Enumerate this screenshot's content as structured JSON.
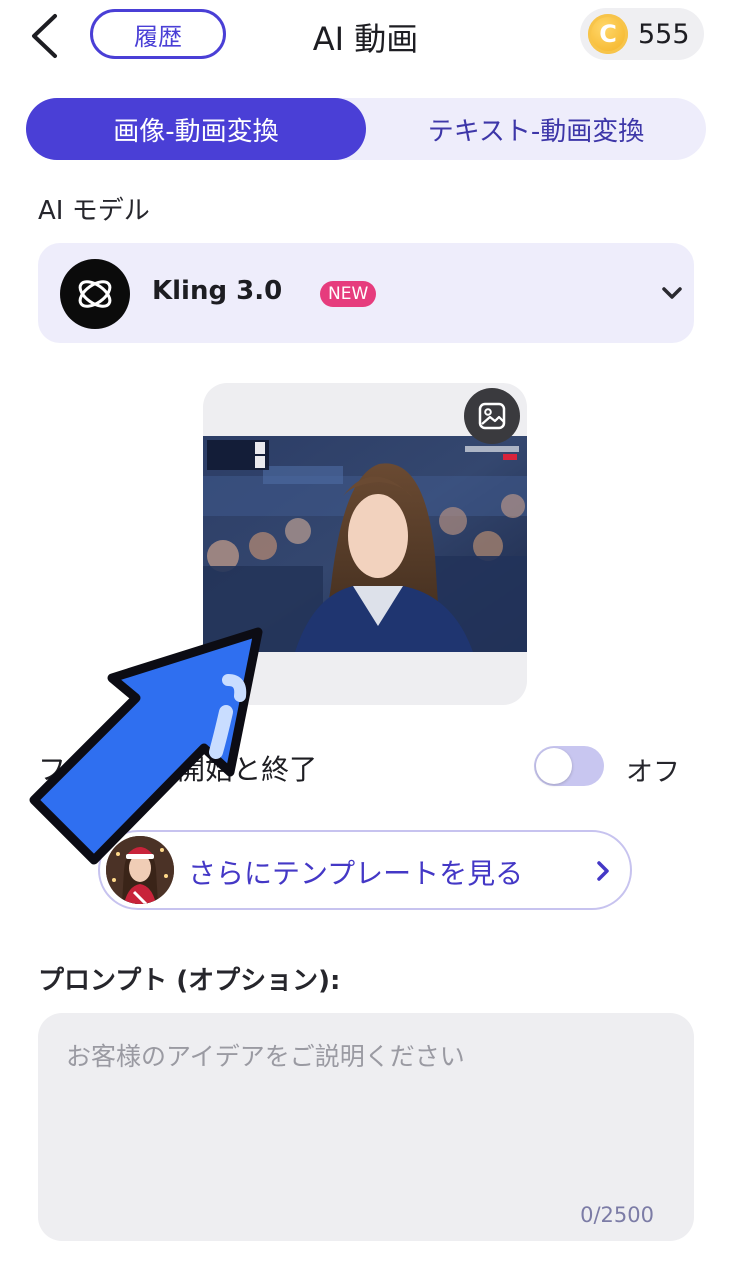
{
  "header": {
    "history_label": "履歴",
    "title": "AI 動画",
    "coin_symbol": "C",
    "coin_balance": "555"
  },
  "mode_tabs": [
    {
      "label": "画像-動画変換",
      "active": true
    },
    {
      "label": "テキスト-動画変換",
      "active": false
    }
  ],
  "model": {
    "section_label": "AI モデル",
    "name": "Kling 3.0",
    "badge": "NEW"
  },
  "frame_option": {
    "label": "フレームの開始と終了",
    "state_label": "オフ",
    "enabled": false
  },
  "templates": {
    "label": "さらにテンプレートを見る"
  },
  "prompt": {
    "label": "プロンプト (オプション):",
    "placeholder": "お客様のアイデアをご説明ください",
    "value": "",
    "char_count": "0/2500"
  },
  "colors": {
    "accent": "#4a3fd6",
    "accent_light": "#eeedfb",
    "badge_pink": "#e63c7d",
    "coin_gold": "#f3ae1c",
    "arrow_blue": "#2f6ff0"
  }
}
